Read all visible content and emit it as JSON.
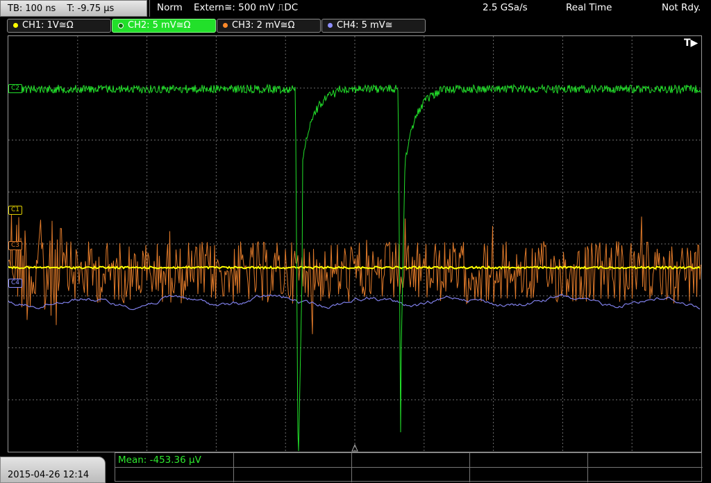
{
  "topbar": {
    "timebase": "TB: 100 ns",
    "trigger_pos": "T: -9.75 µs",
    "mode": "Norm",
    "trigger": "Extern≅: 500 mV ⎍DC",
    "sample_rate": "2.5 GSa/s",
    "acq_mode": "Real Time",
    "status": "Not Rdy."
  },
  "channels": [
    {
      "label": "CH1: 1V≅Ω",
      "color": "#ffff00",
      "active": false
    },
    {
      "label": "CH2: 5 mV≅Ω",
      "color": "#22e02a",
      "active": true
    },
    {
      "label": "CH3: 2 mV≅Ω",
      "color": "#ff8a2a",
      "active": false
    },
    {
      "label": "CH4: 5 mV≅",
      "color": "#8f8fff",
      "active": false
    }
  ],
  "markers": {
    "c1": "C1",
    "c2": "C2",
    "c3": "C3",
    "c4": "C4",
    "trigger": "T▶"
  },
  "colors": {
    "ch1": "#ffff00",
    "ch2": "#22e02a",
    "ch3": "#e07a2a",
    "ch4": "#7f7fe8",
    "grid": "#6e6e6e"
  },
  "bottombar": {
    "datetime": "2015-04-26 12:14",
    "measurement": "Mean: -453.36 µV"
  }
}
